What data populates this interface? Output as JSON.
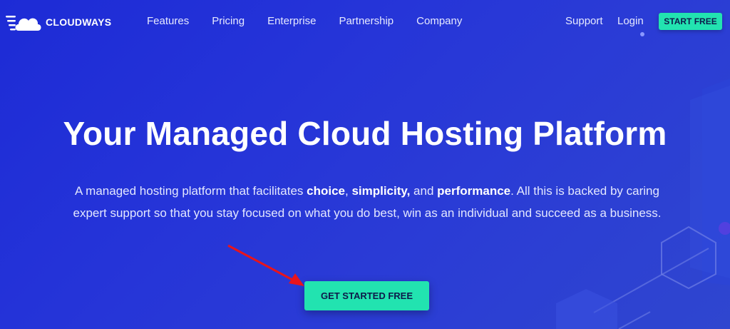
{
  "brand": {
    "name": "CLOUDWAYS",
    "accent": "#22e3b0",
    "background": "#2534d8"
  },
  "nav": {
    "items": [
      {
        "label": "Features"
      },
      {
        "label": "Pricing"
      },
      {
        "label": "Enterprise"
      },
      {
        "label": "Partnership"
      },
      {
        "label": "Company"
      }
    ],
    "support": "Support",
    "login": "Login",
    "start_free": "START FREE"
  },
  "hero": {
    "title": "Your Managed Cloud Hosting Platform",
    "desc_prefix": "A managed hosting platform that facilitates ",
    "desc_choice": "choice",
    "desc_sep1": ", ",
    "desc_simplicity": "simplicity,",
    "desc_and": " and ",
    "desc_performance": "performance",
    "desc_suffix": ". All this is backed by caring expert support so that you stay focused on what you do best, win as an individual and succeed as a business.",
    "cta_label": "GET STARTED FREE"
  },
  "icons": {
    "logo": "cloud-logo-icon",
    "annotation": "red-arrow-icon"
  }
}
